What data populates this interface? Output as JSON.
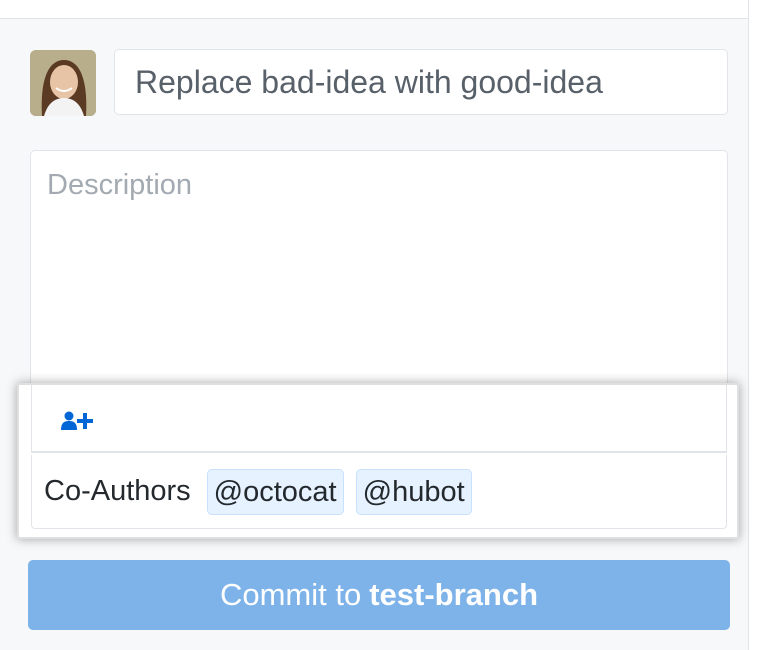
{
  "commit": {
    "summary_placeholder": "Replace bad-idea with good-idea",
    "description_placeholder": "Description",
    "coauthors_label": "Co-Authors",
    "coauthors": [
      "@octocat",
      "@hubot"
    ],
    "button_prefix": "Commit to",
    "button_branch": "test-branch"
  },
  "icons": {
    "avatar": "user-avatar",
    "add_coauthor": "add-person-icon"
  },
  "colors": {
    "accent": "#0366d6",
    "button_bg": "#7eb3e9",
    "token_bg": "#e6f2ff"
  }
}
